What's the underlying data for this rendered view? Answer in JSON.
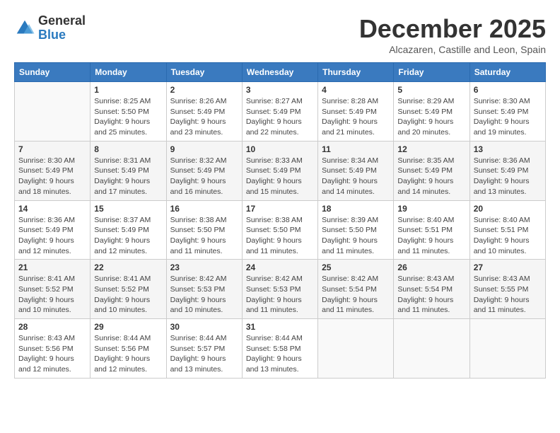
{
  "logo": {
    "general": "General",
    "blue": "Blue"
  },
  "header": {
    "month": "December 2025",
    "location": "Alcazaren, Castille and Leon, Spain"
  },
  "weekdays": [
    "Sunday",
    "Monday",
    "Tuesday",
    "Wednesday",
    "Thursday",
    "Friday",
    "Saturday"
  ],
  "weeks": [
    [
      {
        "num": "",
        "info": ""
      },
      {
        "num": "1",
        "info": "Sunrise: 8:25 AM\nSunset: 5:50 PM\nDaylight: 9 hours\nand 25 minutes."
      },
      {
        "num": "2",
        "info": "Sunrise: 8:26 AM\nSunset: 5:49 PM\nDaylight: 9 hours\nand 23 minutes."
      },
      {
        "num": "3",
        "info": "Sunrise: 8:27 AM\nSunset: 5:49 PM\nDaylight: 9 hours\nand 22 minutes."
      },
      {
        "num": "4",
        "info": "Sunrise: 8:28 AM\nSunset: 5:49 PM\nDaylight: 9 hours\nand 21 minutes."
      },
      {
        "num": "5",
        "info": "Sunrise: 8:29 AM\nSunset: 5:49 PM\nDaylight: 9 hours\nand 20 minutes."
      },
      {
        "num": "6",
        "info": "Sunrise: 8:30 AM\nSunset: 5:49 PM\nDaylight: 9 hours\nand 19 minutes."
      }
    ],
    [
      {
        "num": "7",
        "info": "Sunrise: 8:30 AM\nSunset: 5:49 PM\nDaylight: 9 hours\nand 18 minutes."
      },
      {
        "num": "8",
        "info": "Sunrise: 8:31 AM\nSunset: 5:49 PM\nDaylight: 9 hours\nand 17 minutes."
      },
      {
        "num": "9",
        "info": "Sunrise: 8:32 AM\nSunset: 5:49 PM\nDaylight: 9 hours\nand 16 minutes."
      },
      {
        "num": "10",
        "info": "Sunrise: 8:33 AM\nSunset: 5:49 PM\nDaylight: 9 hours\nand 15 minutes."
      },
      {
        "num": "11",
        "info": "Sunrise: 8:34 AM\nSunset: 5:49 PM\nDaylight: 9 hours\nand 14 minutes."
      },
      {
        "num": "12",
        "info": "Sunrise: 8:35 AM\nSunset: 5:49 PM\nDaylight: 9 hours\nand 14 minutes."
      },
      {
        "num": "13",
        "info": "Sunrise: 8:36 AM\nSunset: 5:49 PM\nDaylight: 9 hours\nand 13 minutes."
      }
    ],
    [
      {
        "num": "14",
        "info": "Sunrise: 8:36 AM\nSunset: 5:49 PM\nDaylight: 9 hours\nand 12 minutes."
      },
      {
        "num": "15",
        "info": "Sunrise: 8:37 AM\nSunset: 5:49 PM\nDaylight: 9 hours\nand 12 minutes."
      },
      {
        "num": "16",
        "info": "Sunrise: 8:38 AM\nSunset: 5:50 PM\nDaylight: 9 hours\nand 11 minutes."
      },
      {
        "num": "17",
        "info": "Sunrise: 8:38 AM\nSunset: 5:50 PM\nDaylight: 9 hours\nand 11 minutes."
      },
      {
        "num": "18",
        "info": "Sunrise: 8:39 AM\nSunset: 5:50 PM\nDaylight: 9 hours\nand 11 minutes."
      },
      {
        "num": "19",
        "info": "Sunrise: 8:40 AM\nSunset: 5:51 PM\nDaylight: 9 hours\nand 11 minutes."
      },
      {
        "num": "20",
        "info": "Sunrise: 8:40 AM\nSunset: 5:51 PM\nDaylight: 9 hours\nand 10 minutes."
      }
    ],
    [
      {
        "num": "21",
        "info": "Sunrise: 8:41 AM\nSunset: 5:52 PM\nDaylight: 9 hours\nand 10 minutes."
      },
      {
        "num": "22",
        "info": "Sunrise: 8:41 AM\nSunset: 5:52 PM\nDaylight: 9 hours\nand 10 minutes."
      },
      {
        "num": "23",
        "info": "Sunrise: 8:42 AM\nSunset: 5:53 PM\nDaylight: 9 hours\nand 10 minutes."
      },
      {
        "num": "24",
        "info": "Sunrise: 8:42 AM\nSunset: 5:53 PM\nDaylight: 9 hours\nand 11 minutes."
      },
      {
        "num": "25",
        "info": "Sunrise: 8:42 AM\nSunset: 5:54 PM\nDaylight: 9 hours\nand 11 minutes."
      },
      {
        "num": "26",
        "info": "Sunrise: 8:43 AM\nSunset: 5:54 PM\nDaylight: 9 hours\nand 11 minutes."
      },
      {
        "num": "27",
        "info": "Sunrise: 8:43 AM\nSunset: 5:55 PM\nDaylight: 9 hours\nand 11 minutes."
      }
    ],
    [
      {
        "num": "28",
        "info": "Sunrise: 8:43 AM\nSunset: 5:56 PM\nDaylight: 9 hours\nand 12 minutes."
      },
      {
        "num": "29",
        "info": "Sunrise: 8:44 AM\nSunset: 5:56 PM\nDaylight: 9 hours\nand 12 minutes."
      },
      {
        "num": "30",
        "info": "Sunrise: 8:44 AM\nSunset: 5:57 PM\nDaylight: 9 hours\nand 13 minutes."
      },
      {
        "num": "31",
        "info": "Sunrise: 8:44 AM\nSunset: 5:58 PM\nDaylight: 9 hours\nand 13 minutes."
      },
      {
        "num": "",
        "info": ""
      },
      {
        "num": "",
        "info": ""
      },
      {
        "num": "",
        "info": ""
      }
    ]
  ]
}
